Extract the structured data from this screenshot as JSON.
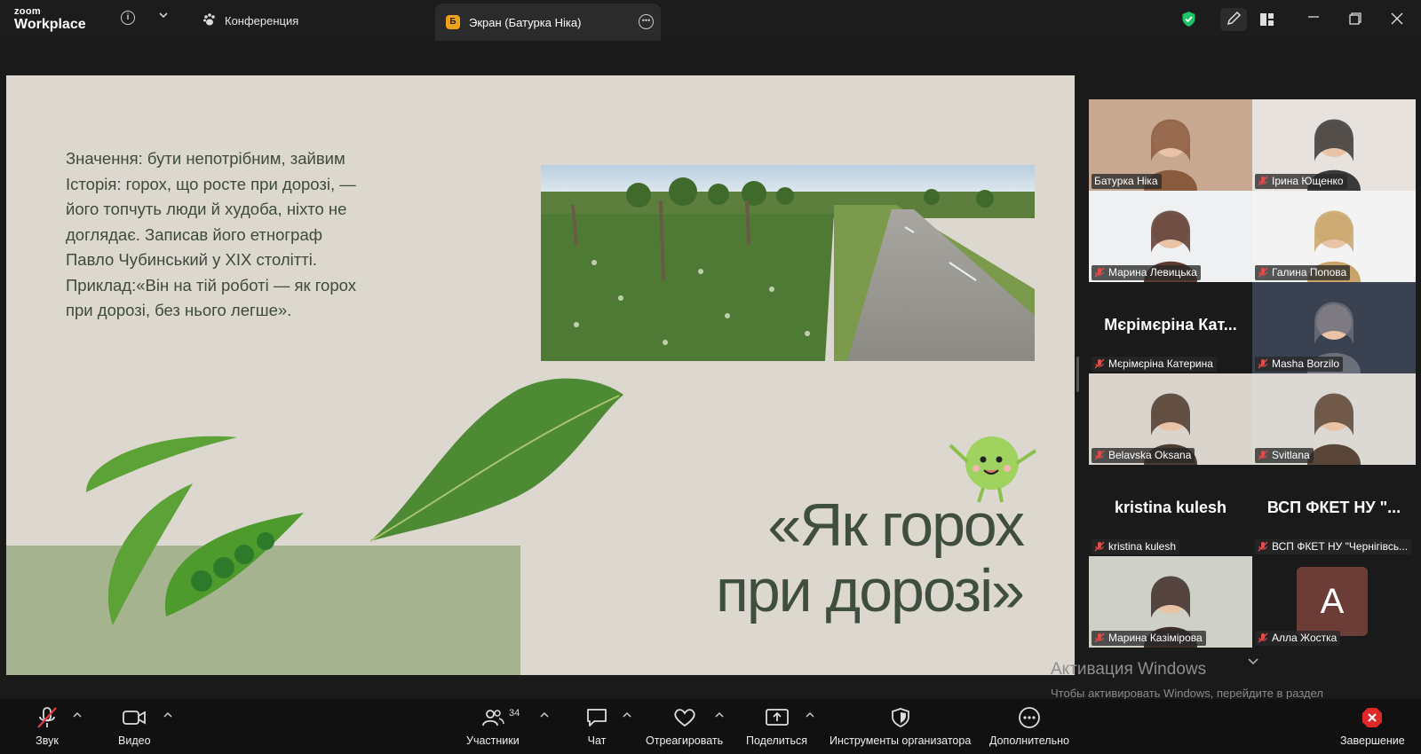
{
  "titlebar": {
    "logo_top": "zoom",
    "logo_bottom": "Workplace",
    "tab_conference": "Конференция",
    "tab_screen": "Экран (Батурка Ніка)",
    "tab_screen_badge": "Б"
  },
  "slide": {
    "text_lines": [
      "Значення: бути непотрібним, зайвим",
      "Історія: горох, що росте при дорозі, —",
      "його топчуть люди й худоба, ніхто не",
      "доглядає. Записав його етнограф",
      "Павло Чубинський у XIX столітті.",
      "Приклад:«Він на тій роботі — як горох",
      "при дорозі, без нього легше»."
    ],
    "title_line1": "«Як горох",
    "title_line2": "при дорозі»"
  },
  "gallery": [
    {
      "name": "Батурка Ніка",
      "muted": false,
      "video": true,
      "active": true,
      "big": ""
    },
    {
      "name": "Ірина Ющенко",
      "muted": true,
      "video": true,
      "active": false,
      "big": ""
    },
    {
      "name": "Марина Левицька",
      "muted": true,
      "video": true,
      "active": false,
      "big": ""
    },
    {
      "name": "Галина Попова",
      "muted": true,
      "video": true,
      "active": false,
      "big": ""
    },
    {
      "name": "Мєрімєріна Катерина",
      "muted": true,
      "video": false,
      "active": false,
      "big": "Мєрімєріна Кат..."
    },
    {
      "name": "Masha Borzilo",
      "muted": true,
      "video": true,
      "active": false,
      "big": ""
    },
    {
      "name": "Belavska Oksana",
      "muted": true,
      "video": true,
      "active": false,
      "big": ""
    },
    {
      "name": "Svitlana",
      "muted": true,
      "video": true,
      "active": false,
      "big": ""
    },
    {
      "name": "kristina kulesh",
      "muted": true,
      "video": false,
      "active": false,
      "big": "kristina kulesh"
    },
    {
      "name": "ВСП ФКЕТ НУ \"Чернігівсь...",
      "muted": true,
      "video": false,
      "active": false,
      "big": "ВСП ФКЕТ НУ \"..."
    },
    {
      "name": "Марина Казімірова",
      "muted": true,
      "video": true,
      "active": false,
      "big": ""
    },
    {
      "name": "Алла Жостка",
      "muted": true,
      "video": false,
      "active": false,
      "big": "",
      "avatar": "A"
    }
  ],
  "activation": {
    "title": "Активация Windows",
    "text": "Чтобы активировать Windows, перейдите в раздел \"Параметры\"."
  },
  "toolbar": {
    "audio": "Звук",
    "video": "Видео",
    "participants": "Участники",
    "participants_count": "34",
    "chat": "Чат",
    "react": "Отреагировать",
    "share": "Поделиться",
    "host_tools": "Инструменты организатора",
    "more": "Дополнительно",
    "end": "Завершение"
  },
  "colors": {
    "active_speaker": "#26c26e",
    "slide_bg": "#dcd8d0",
    "end_red": "#e02828",
    "security_green": "#1fc266"
  }
}
